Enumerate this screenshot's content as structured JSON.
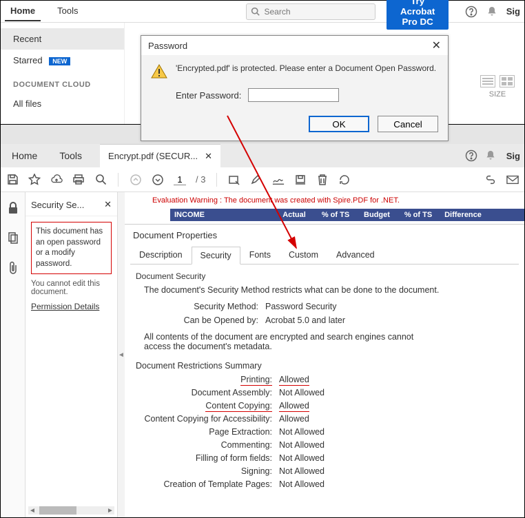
{
  "top": {
    "home": "Home",
    "tools": "Tools",
    "search_placeholder": "Search",
    "try_btn": "Try Acrobat Pro DC",
    "sign": "Sig"
  },
  "home_sidebar": {
    "recent": "Recent",
    "starred": "Starred",
    "new_badge": "NEW",
    "doc_cloud": "DOCUMENT CLOUD",
    "all_files": "All files"
  },
  "view_toggle_label": "SIZE",
  "pwd_dialog": {
    "title": "Password",
    "message": "'Encrypted.pdf' is protected. Please enter a Document Open Password.",
    "enter_label": "Enter Password:",
    "ok": "OK",
    "cancel": "Cancel"
  },
  "doc": {
    "home": "Home",
    "tools": "Tools",
    "filename_tab": "Encrypt.pdf (SECUR...",
    "sign": "Sig",
    "page_current": "1",
    "page_total": "/   3"
  },
  "sec_panel": {
    "title": "Security Se...",
    "red_note": "This document has an open password or a modify password.",
    "no_edit": "You cannot edit this document.",
    "perm_link": "Permission Details"
  },
  "eval_warning": "Evaluation Warning : The document was created with Spire.PDF for .NET.",
  "income_headers": {
    "c1": "INCOME",
    "actual": "Actual",
    "pct1": "% of TS",
    "budget": "Budget",
    "pct2": "% of TS",
    "diff": "Difference"
  },
  "props": {
    "title": "Document Properties",
    "tabs": {
      "description": "Description",
      "security": "Security",
      "fonts": "Fonts",
      "custom": "Custom",
      "advanced": "Advanced"
    },
    "section_label": "Document Security",
    "desc": "The document's Security Method restricts what can be done to the document.",
    "method_k": "Security Method:",
    "method_v": "Password Security",
    "open_k": "Can be Opened by:",
    "open_v": "Acrobat 5.0 and later",
    "encrypt_note": "All contents of the document are encrypted and search engines cannot access the document's metadata.",
    "restrict_hdr": "Document Restrictions Summary",
    "restrictions": [
      {
        "k": "Printing:",
        "v": "Allowed",
        "hl": true
      },
      {
        "k": "Document Assembly:",
        "v": "Not Allowed"
      },
      {
        "k": "Content Copying:",
        "v": "Allowed",
        "hl": true
      },
      {
        "k": "Content Copying for Accessibility:",
        "v": "Allowed"
      },
      {
        "k": "Page Extraction:",
        "v": "Not Allowed"
      },
      {
        "k": "Commenting:",
        "v": "Not Allowed"
      },
      {
        "k": "Filling of form fields:",
        "v": "Not Allowed"
      },
      {
        "k": "Signing:",
        "v": "Not Allowed"
      },
      {
        "k": "Creation of Template Pages:",
        "v": "Not Allowed"
      }
    ]
  }
}
